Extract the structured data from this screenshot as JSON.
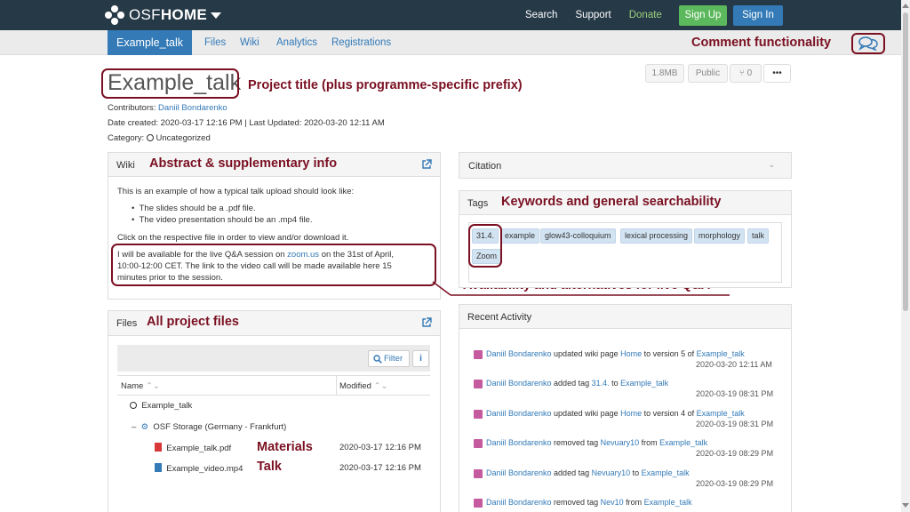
{
  "navbar": {
    "brand_light": "OSF",
    "brand_bold": "HOME",
    "links": [
      "Search",
      "Support",
      "Donate"
    ],
    "signup": "Sign Up",
    "signin": "Sign In"
  },
  "subnav": {
    "active": "Example_talk",
    "tabs": [
      "Files",
      "Wiki",
      "Analytics",
      "Registrations"
    ]
  },
  "annotations": {
    "comment": "Comment functionality",
    "title": "Project title (plus programme-specific prefix)",
    "abstract": "Abstract & supplementary info",
    "keywords": "Keywords and general searchability",
    "availability": "Availability and alternatives for live Q&A",
    "files": "All project files",
    "materials": "Materials",
    "talk": "Talk"
  },
  "project": {
    "title": "Example_talk",
    "contributors_label": "Contributors:",
    "contributor": "Daniil Bondarenko",
    "dates": "Date created: 2020-03-17 12:16 PM | Last Updated: 2020-03-20 12:11 AM",
    "category_label": "Category:",
    "category": "Uncategorized",
    "size": "1.8MB",
    "visibility": "Public",
    "forks": "0",
    "more": "•••"
  },
  "wiki": {
    "heading": "Wiki",
    "intro": "This is an example of how a typical talk upload should look like:",
    "bullets": [
      "The slides should be a .pdf file.",
      "The video presentation should be an .mp4 file."
    ],
    "click_text": "Click on the respective file in order to view and/or download it.",
    "qa_line1_a": "I will be available for the live Q&A session on ",
    "qa_link": "zoom.us",
    "qa_line1_b": " on the 31st of April,",
    "qa_line2": "10:00-12:00 CET. The link to the video call will be made available here 15",
    "qa_line3": "minutes prior to the session."
  },
  "citation": {
    "heading": "Citation"
  },
  "tags": {
    "heading": "Tags",
    "items": [
      "31.4.",
      "example",
      "glow43-colloquium",
      "lexical processing",
      "morphology",
      "talk",
      "Zoom"
    ]
  },
  "files": {
    "heading": "Files",
    "filter": "Filter",
    "info": "i",
    "col_name": "Name",
    "col_modified": "Modified",
    "root": "Example_talk",
    "storage": "OSF Storage (Germany - Frankfurt)",
    "items": [
      {
        "name": "Example_talk.pdf",
        "modified": "2020-03-17 12:16 PM"
      },
      {
        "name": "Example_video.mp4",
        "modified": "2020-03-17 12:16 PM"
      }
    ]
  },
  "activity": {
    "heading": "Recent Activity",
    "entries": [
      {
        "user": "Daniil Bondarenko",
        "a": " updated wiki page ",
        "link1": "Home",
        "b": " to version 5 of ",
        "link2": "Example_talk",
        "time": "2020-03-20 12:11 AM"
      },
      {
        "user": "Daniil Bondarenko",
        "a": " added tag ",
        "link1": "31.4.",
        "b": " to ",
        "link2": "Example_talk",
        "time": "2020-03-19 08:31 PM"
      },
      {
        "user": "Daniil Bondarenko",
        "a": " updated wiki page ",
        "link1": "Home",
        "b": " to version 4 of ",
        "link2": "Example_talk",
        "time": "2020-03-19 08:31 PM"
      },
      {
        "user": "Daniil Bondarenko",
        "a": " removed tag ",
        "link1": "Nevuary10",
        "b": " from ",
        "link2": "Example_talk",
        "time": "2020-03-19 08:29 PM"
      },
      {
        "user": "Daniil Bondarenko",
        "a": " added tag ",
        "link1": "Nevuary10",
        "b": " to ",
        "link2": "Example_talk",
        "time": "2020-03-19 08:29 PM"
      },
      {
        "user": "Daniil Bondarenko",
        "a": " removed tag ",
        "link1": "Nev10",
        "b": " from ",
        "link2": "Example_talk",
        "time": ""
      }
    ]
  },
  "colors": {
    "navbar": "#263947",
    "link": "#337ab7",
    "annotation": "#7a1022",
    "signup": "#5cb85c"
  }
}
